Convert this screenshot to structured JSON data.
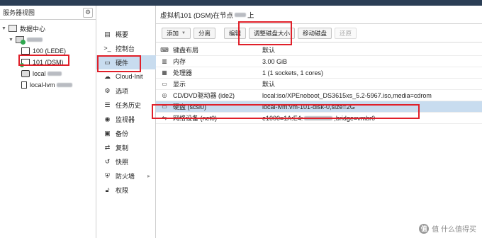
{
  "left": {
    "title": "服务器视图",
    "tree": [
      {
        "label": "数据中心"
      },
      {
        "label": ""
      },
      {
        "label": "100 (LEDE)"
      },
      {
        "label": "101 (DSM)"
      },
      {
        "label": "local"
      },
      {
        "label": "local-lvm"
      }
    ]
  },
  "menu": {
    "items": [
      {
        "label": "概要",
        "icon": "book-icon"
      },
      {
        "label": "控制台",
        "icon": "terminal-icon"
      },
      {
        "label": "硬件",
        "icon": "monitor-icon"
      },
      {
        "label": "Cloud-Init",
        "icon": "cloud-icon"
      },
      {
        "label": "选项",
        "icon": "gear-icon"
      },
      {
        "label": "任务历史",
        "icon": "list-icon"
      },
      {
        "label": "监视器",
        "icon": "eye-icon"
      },
      {
        "label": "备份",
        "icon": "floppy-icon"
      },
      {
        "label": "复制",
        "icon": "retweet-icon"
      },
      {
        "label": "快照",
        "icon": "history-icon"
      },
      {
        "label": "防火墙",
        "icon": "shield-icon"
      },
      {
        "label": "权限",
        "icon": "unlock-icon"
      }
    ]
  },
  "main": {
    "header": "虚拟机101 (DSM)在节点",
    "header_suffix": "上",
    "toolbar": {
      "add": "添加",
      "detach": "分离",
      "edit": "编辑",
      "resize": "调整磁盘大小",
      "move": "移动磁盘",
      "revert": "还原"
    },
    "rows": [
      {
        "key": "键盘布局",
        "value": "默认",
        "icon": "keyboard-icon"
      },
      {
        "key": "内存",
        "value": "3.00 GiB",
        "icon": "memory-icon"
      },
      {
        "key": "处理器",
        "value": "1 (1 sockets, 1 cores)",
        "icon": "cpu-icon"
      },
      {
        "key": "显示",
        "value": "默认",
        "icon": "desktop-icon"
      },
      {
        "key": "CD/DVD驱动器 (ide2)",
        "value": "local:iso/XPEnoboot_DS3615xs_5.2-5967.iso,media=cdrom",
        "icon": "cdrom-icon"
      },
      {
        "key": "硬盘 (scsi0)",
        "value": "local-lvm:vm-101-disk-0,size=2G",
        "icon": "hdd-icon"
      },
      {
        "key": "网络设备 (net0)",
        "value_a": "e1000=1A:E4:",
        "value_b": ",bridge=vmbr0",
        "icon": "network-icon"
      }
    ]
  },
  "watermark": {
    "text": "值 什么值得买",
    "logo": "值"
  }
}
